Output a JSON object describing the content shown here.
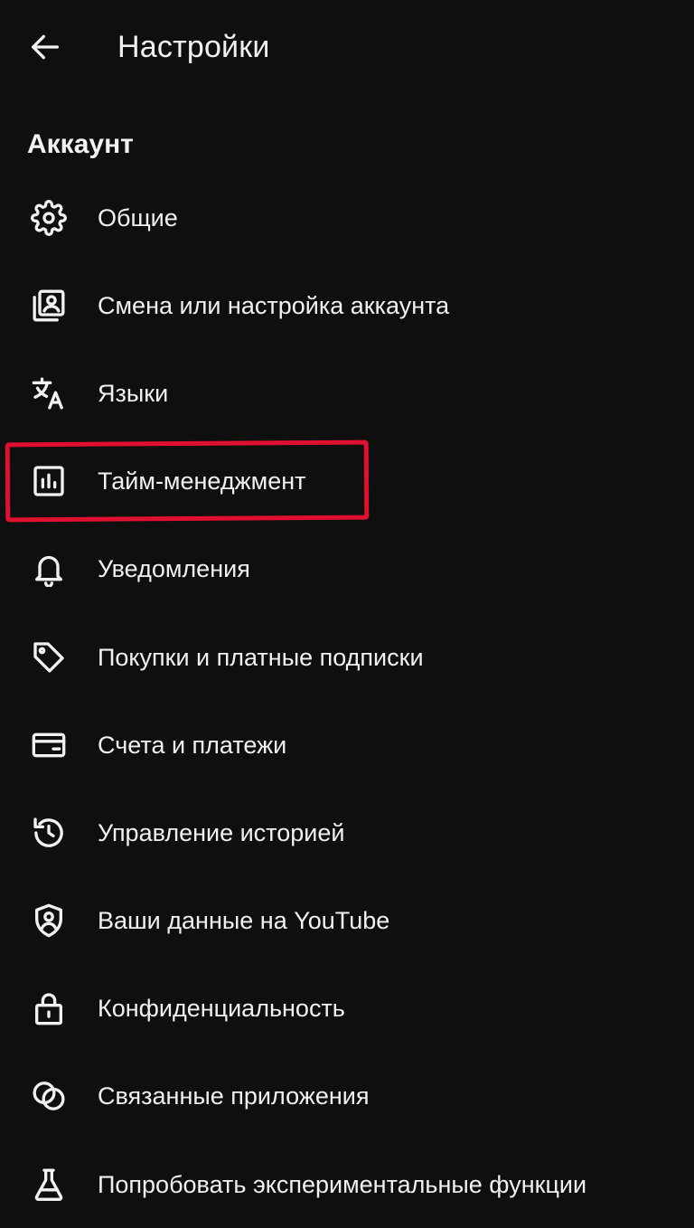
{
  "header": {
    "title": "Настройки",
    "back_icon": "arrow-left-icon"
  },
  "section": {
    "title": "Аккаунт"
  },
  "items": [
    {
      "label": "Общие",
      "icon": "gear-icon"
    },
    {
      "label": "Смена или настройка аккаунта",
      "icon": "account-box-icon"
    },
    {
      "label": "Языки",
      "icon": "translate-icon"
    },
    {
      "label": "Тайм-менеджмент",
      "icon": "bar-chart-icon"
    },
    {
      "label": "Уведомления",
      "icon": "bell-icon"
    },
    {
      "label": "Покупки и платные подписки",
      "icon": "tag-icon"
    },
    {
      "label": "Счета и платежи",
      "icon": "credit-card-icon"
    },
    {
      "label": "Управление историей",
      "icon": "history-icon"
    },
    {
      "label": "Ваши данные на YouTube",
      "icon": "shield-person-icon"
    },
    {
      "label": "Конфиденциальность",
      "icon": "lock-icon"
    },
    {
      "label": "Связанные приложения",
      "icon": "linked-circles-icon"
    },
    {
      "label": "Попробовать экспериментальные функции",
      "icon": "flask-icon"
    }
  ],
  "colors": {
    "background": "#0f0f0f",
    "text": "#f1f1f1",
    "highlight": "#e01030"
  }
}
